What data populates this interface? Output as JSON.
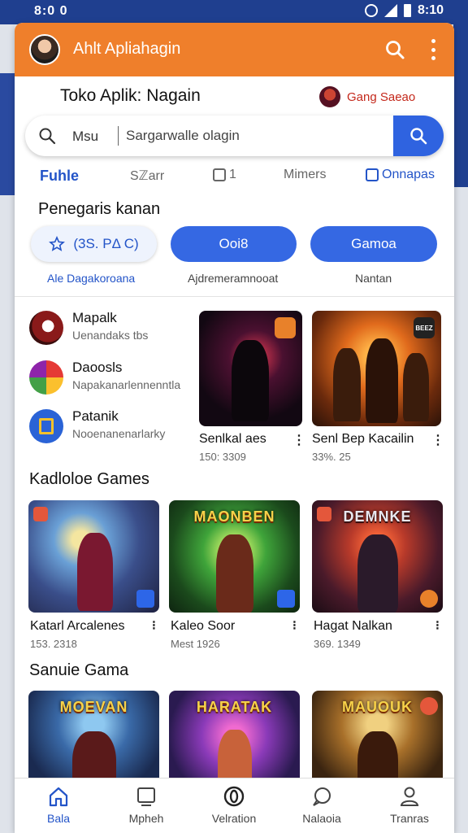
{
  "status": {
    "time": "8:0 0",
    "right_time": "8:10"
  },
  "appbar": {
    "title": "Ahlt Apliahagin",
    "search_icon": "search-icon",
    "more_icon": "more-vert-icon"
  },
  "store": {
    "title": "Toko Aplik: Nagain",
    "user_name": "Gang Saeao"
  },
  "search": {
    "menu_label": "Msu",
    "placeholder": "Sargarwalle olagin"
  },
  "tabs": [
    {
      "label": "Fuhle"
    },
    {
      "label": "Sℤarr"
    },
    {
      "label": "1"
    },
    {
      "label": "Mimers"
    },
    {
      "label": "Onnapas"
    }
  ],
  "section1": {
    "title": "Penegaris  kanan"
  },
  "pills": [
    {
      "label": "(3S. PΔ C)",
      "caption": "Ale Dagakoroana"
    },
    {
      "label": "Ooi8",
      "caption": "Ajdremeramnooat"
    },
    {
      "label": "Gamoa",
      "caption": "Nantan"
    }
  ],
  "apps": [
    {
      "name": "Mapalk",
      "sub": "Uenandaks tbs"
    },
    {
      "name": "Daoosls",
      "sub": "Napakanarlennenntla"
    },
    {
      "name": "Patanik",
      "sub": "Nooenanenarlarky"
    }
  ],
  "featured": [
    {
      "name": "Senlkal aes",
      "meta": "150: 3309",
      "badge": ""
    },
    {
      "name": "Senl Bep Kacailin",
      "meta": "33%. 25",
      "badge": "BEEZ"
    }
  ],
  "section2": {
    "title": "Kadloloe Games"
  },
  "games1": [
    {
      "name": "Katarl Arcalenes",
      "meta": "153. 2318",
      "art_title": ""
    },
    {
      "name": "Kaleo Soor",
      "meta": "Mest 1926",
      "art_title": "MAONBEN"
    },
    {
      "name": "Hagat Nalkan",
      "meta": "369. 1349",
      "art_title": "DEMNKE"
    }
  ],
  "section3": {
    "title": "Sanuie Gama"
  },
  "games2": [
    {
      "art_title": "MOEVAN"
    },
    {
      "art_title": "HARATAK"
    },
    {
      "art_title": "MAUOUK"
    }
  ],
  "nav": [
    {
      "label": "Bala",
      "icon": "home-icon"
    },
    {
      "label": "Mpheh",
      "icon": "inbox-icon"
    },
    {
      "label": "Velration",
      "icon": "circle-icon"
    },
    {
      "label": "Nalaoia",
      "icon": "chat-icon"
    },
    {
      "label": "Tranras",
      "icon": "person-icon"
    }
  ],
  "colors": {
    "accent": "#ef7f2b",
    "primary": "#3568e3",
    "statusbar": "#1f3f8f"
  }
}
